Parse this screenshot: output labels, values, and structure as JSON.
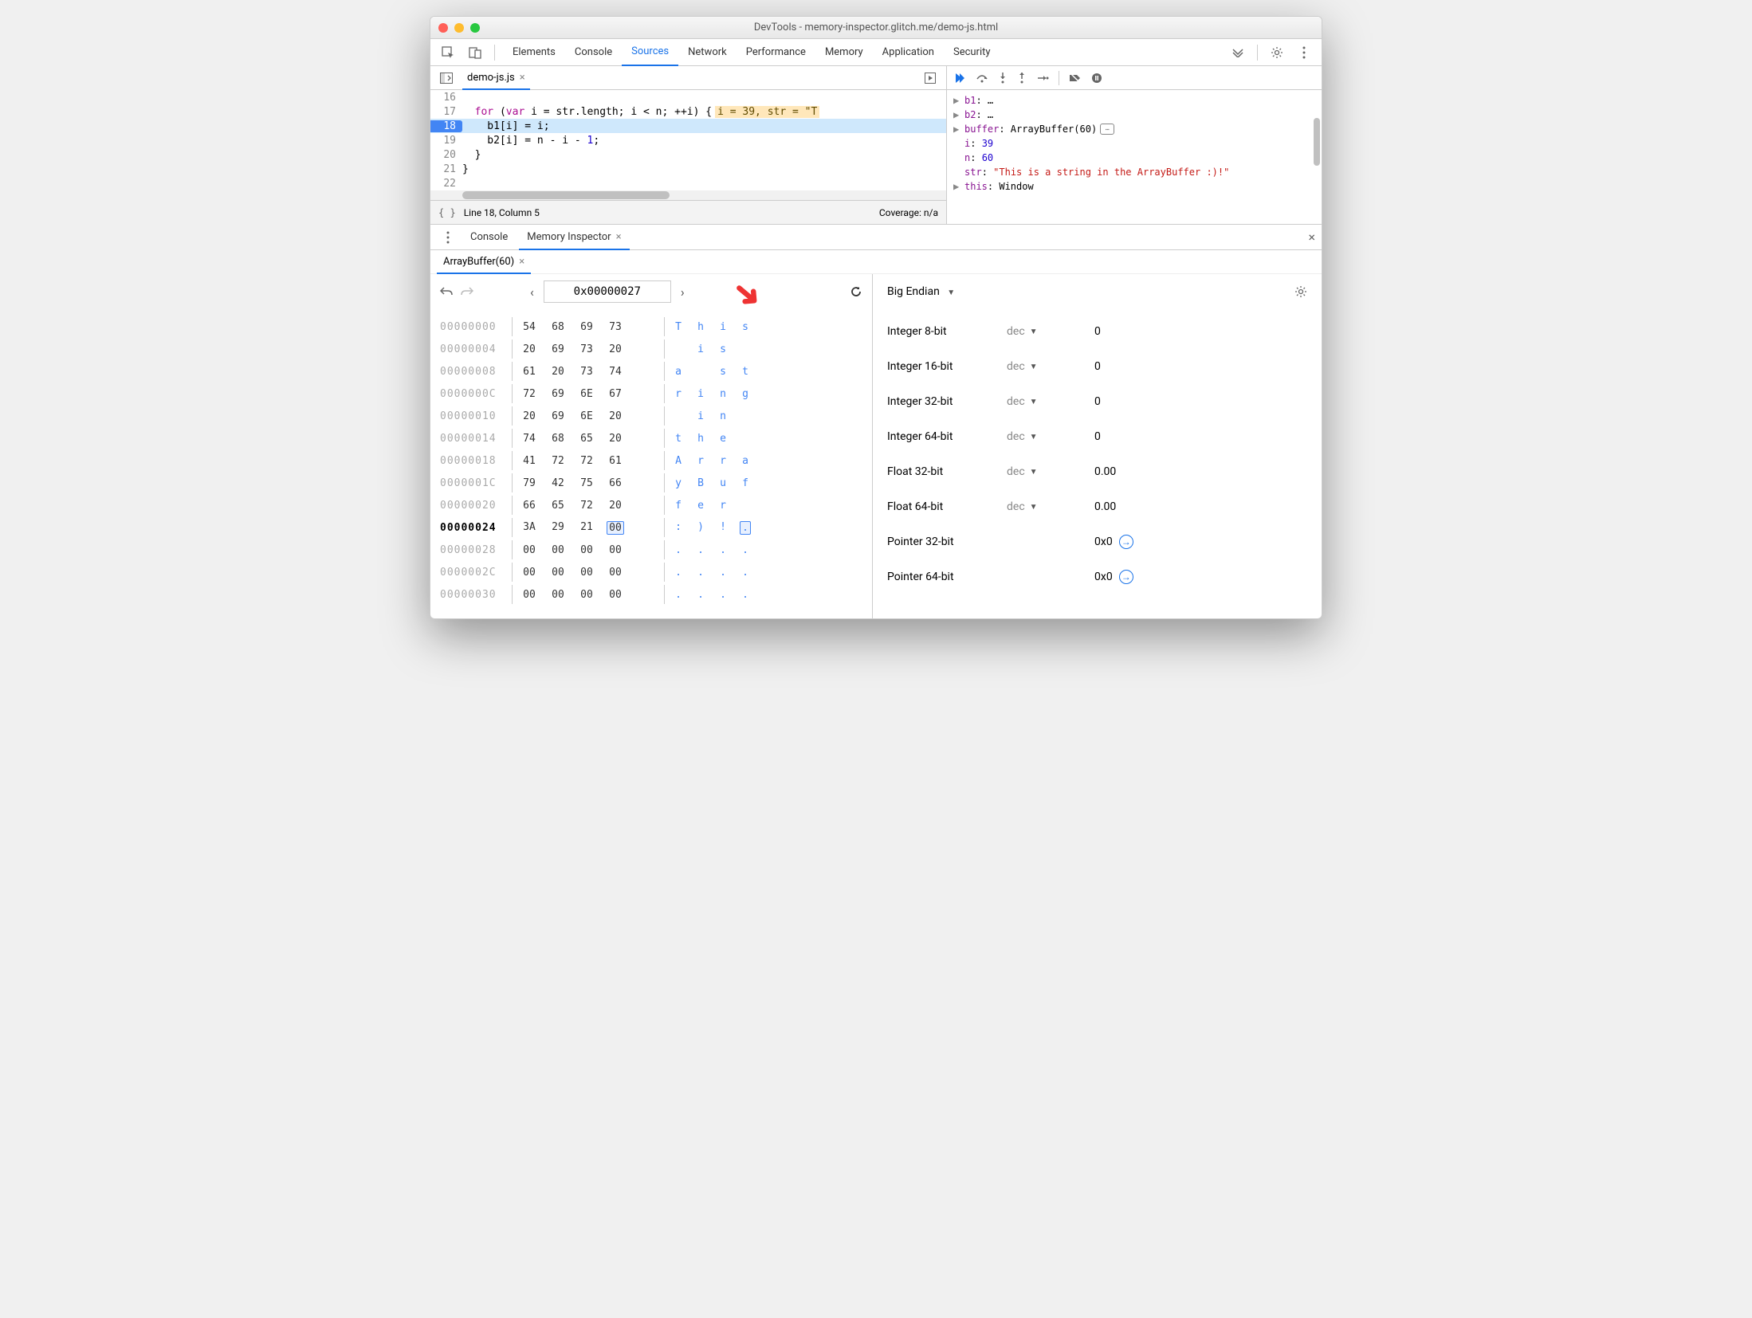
{
  "window": {
    "title": "DevTools - memory-inspector.glitch.me/demo-js.html"
  },
  "tabs": {
    "items": [
      "Elements",
      "Console",
      "Sources",
      "Network",
      "Performance",
      "Memory",
      "Application",
      "Security"
    ],
    "active": "Sources"
  },
  "sources": {
    "file_tab": "demo-js.js",
    "lines": [
      {
        "num": "16",
        "text": ""
      },
      {
        "num": "17",
        "text_html": "  <span class='kw'>for</span> (<span class='kw'>var</span> i = str.length; i &lt; n; ++i) {",
        "inline": "i = 39, str = \"T"
      },
      {
        "num": "18",
        "text_html": "    b1[i] = i;",
        "bp": true,
        "hl": true
      },
      {
        "num": "19",
        "text_html": "    b2[i] = n - i - <span class='num'>1</span>;"
      },
      {
        "num": "20",
        "text_html": "  }"
      },
      {
        "num": "21",
        "text_html": "}"
      },
      {
        "num": "22",
        "text_html": ""
      }
    ],
    "status_pos": "Line 18, Column 5",
    "status_cov": "Coverage: n/a"
  },
  "scope": {
    "rows": [
      {
        "arrow": "▶",
        "name": "b1",
        "after": ": …"
      },
      {
        "arrow": "▶",
        "name": "b2",
        "after": ": …"
      },
      {
        "arrow": "▶",
        "name": "buffer",
        "after": ": ArrayBuffer(60)",
        "badge": true
      },
      {
        "arrow": "",
        "indent": "   ",
        "name": "i",
        "val_num": "39"
      },
      {
        "arrow": "",
        "indent": "   ",
        "name": "n",
        "val_num": "60"
      },
      {
        "arrow": "",
        "indent": "   ",
        "name": "str",
        "val_str": "\"This is a string in the ArrayBuffer :)!\""
      },
      {
        "arrow": "▶",
        "name": "this",
        "after": ": Window"
      }
    ]
  },
  "drawer": {
    "tabs": {
      "console": "Console",
      "mi": "Memory Inspector"
    },
    "buffer_tab": "ArrayBuffer(60)"
  },
  "memory_inspector": {
    "address": "0x00000027",
    "endian_label": "Big Endian",
    "hex_rows": [
      {
        "addr": "00000000",
        "hex": [
          "54",
          "68",
          "69",
          "73"
        ],
        "asc": [
          "T",
          "h",
          "i",
          "s"
        ]
      },
      {
        "addr": "00000004",
        "hex": [
          "20",
          "69",
          "73",
          "20"
        ],
        "asc": [
          " ",
          "i",
          "s",
          " "
        ]
      },
      {
        "addr": "00000008",
        "hex": [
          "61",
          "20",
          "73",
          "74"
        ],
        "asc": [
          "a",
          " ",
          "s",
          "t"
        ]
      },
      {
        "addr": "0000000C",
        "hex": [
          "72",
          "69",
          "6E",
          "67"
        ],
        "asc": [
          "r",
          "i",
          "n",
          "g"
        ]
      },
      {
        "addr": "00000010",
        "hex": [
          "20",
          "69",
          "6E",
          "20"
        ],
        "asc": [
          " ",
          "i",
          "n",
          " "
        ]
      },
      {
        "addr": "00000014",
        "hex": [
          "74",
          "68",
          "65",
          "20"
        ],
        "asc": [
          "t",
          "h",
          "e",
          " "
        ]
      },
      {
        "addr": "00000018",
        "hex": [
          "41",
          "72",
          "72",
          "61"
        ],
        "asc": [
          "A",
          "r",
          "r",
          "a"
        ]
      },
      {
        "addr": "0000001C",
        "hex": [
          "79",
          "42",
          "75",
          "66"
        ],
        "asc": [
          "y",
          "B",
          "u",
          "f"
        ]
      },
      {
        "addr": "00000020",
        "hex": [
          "66",
          "65",
          "72",
          "20"
        ],
        "asc": [
          "f",
          "e",
          "r",
          " "
        ]
      },
      {
        "addr": "00000024",
        "hex": [
          "3A",
          "29",
          "21",
          "00"
        ],
        "asc": [
          ":",
          ")",
          "!",
          "."
        ],
        "hl": true,
        "sel": 3
      },
      {
        "addr": "00000028",
        "hex": [
          "00",
          "00",
          "00",
          "00"
        ],
        "asc": [
          ".",
          ".",
          ".",
          "."
        ]
      },
      {
        "addr": "0000002C",
        "hex": [
          "00",
          "00",
          "00",
          "00"
        ],
        "asc": [
          ".",
          ".",
          ".",
          "."
        ]
      },
      {
        "addr": "00000030",
        "hex": [
          "00",
          "00",
          "00",
          "00"
        ],
        "asc": [
          ".",
          ".",
          ".",
          "."
        ]
      }
    ],
    "types": [
      {
        "label": "Integer 8-bit",
        "fmt": "dec",
        "val": "0"
      },
      {
        "label": "Integer 16-bit",
        "fmt": "dec",
        "val": "0"
      },
      {
        "label": "Integer 32-bit",
        "fmt": "dec",
        "val": "0"
      },
      {
        "label": "Integer 64-bit",
        "fmt": "dec",
        "val": "0"
      },
      {
        "label": "Float 32-bit",
        "fmt": "dec",
        "val": "0.00"
      },
      {
        "label": "Float 64-bit",
        "fmt": "dec",
        "val": "0.00"
      },
      {
        "label": "Pointer 32-bit",
        "fmt": "",
        "val": "0x0",
        "ptr": true
      },
      {
        "label": "Pointer 64-bit",
        "fmt": "",
        "val": "0x0",
        "ptr": true
      }
    ]
  }
}
